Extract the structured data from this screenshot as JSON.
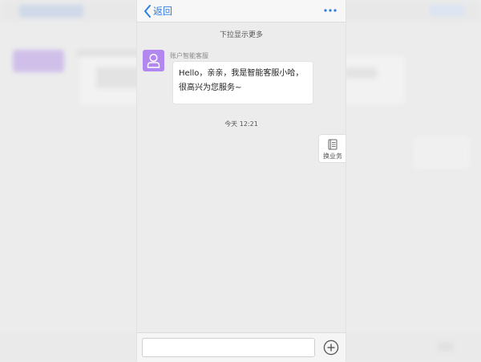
{
  "nav": {
    "back_label": "返回",
    "back_icon": "chevron-left-icon",
    "more_icon": "more-dots-icon"
  },
  "chat": {
    "pull_hint": "下拉显示更多",
    "agent_name": "账户智能客服",
    "agent_avatar_icon": "user-icon",
    "welcome_message": "Hello，亲亲，我是智能客服小哈，很高兴为您服务~",
    "time": "今天 12:21"
  },
  "side_action": {
    "label": "换业务",
    "icon": "document-list-icon"
  },
  "composer": {
    "input_value": "",
    "plus_icon": "plus-circle-icon"
  },
  "colors": {
    "accent": "#2f7de1",
    "avatar_bg": "#b387f0"
  }
}
